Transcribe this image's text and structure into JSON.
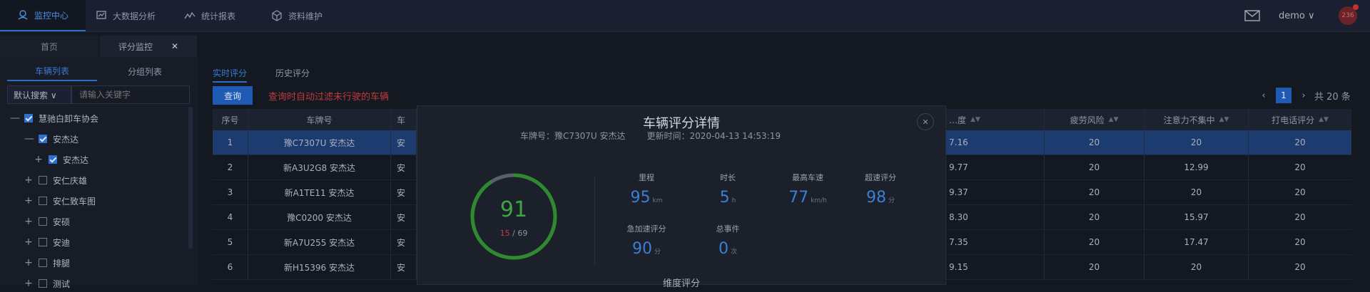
{
  "nav": {
    "items": [
      {
        "label": "监控中心",
        "icon": "monitor-icon",
        "active": true
      },
      {
        "label": "大数据分析",
        "icon": "bigdata-icon",
        "active": false
      },
      {
        "label": "统计报表",
        "icon": "chart-line-icon",
        "active": false
      },
      {
        "label": "资料维护",
        "icon": "cube-icon",
        "active": false
      }
    ],
    "user": "demo ∨",
    "avatar_text": "236"
  },
  "page_tabs": {
    "home": "首页",
    "current": "评分监控",
    "close": "✕"
  },
  "sidebar": {
    "tab_vehicles": "车辆列表",
    "tab_groups": "分组列表",
    "select_value": "默认搜索 ∨",
    "search_placeholder": "请输入关键字",
    "tree": [
      {
        "expander": "—",
        "checked": true,
        "label": "慧驰白卸车协会"
      },
      {
        "expander": "—",
        "checked": true,
        "label": "安杰达"
      },
      {
        "expander": "+",
        "checked": true,
        "label": "安杰达"
      },
      {
        "expander": "+",
        "checked": false,
        "label": "安仁庆雄"
      },
      {
        "expander": "+",
        "checked": false,
        "label": "安仁致车图"
      },
      {
        "expander": "+",
        "checked": false,
        "label": "安硕"
      },
      {
        "expander": "+",
        "checked": false,
        "label": "安迪"
      },
      {
        "expander": "+",
        "checked": false,
        "label": "排腿"
      },
      {
        "expander": "+",
        "checked": false,
        "label": "测试"
      }
    ]
  },
  "main": {
    "tab_realtime": "实时评分",
    "tab_history": "历史评分",
    "query_label": "查询",
    "warning": "查询时自动过滤未行驶的车辆",
    "pager": {
      "prev": "‹",
      "page": "1",
      "next": "›",
      "total": "共 20 条"
    }
  },
  "table": {
    "headers": [
      "序号",
      "车牌号",
      "车",
      "…度",
      "疲劳风险",
      "注意力不集中",
      "打电话评分"
    ],
    "rows": [
      [
        "1",
        "豫C7307U 安杰达",
        "安",
        "7.16",
        "20",
        "20",
        "20"
      ],
      [
        "2",
        "新A3U2G8 安杰达",
        "安",
        "9.77",
        "20",
        "12.99",
        "20"
      ],
      [
        "3",
        "新A1TE11 安杰达",
        "安",
        "9.37",
        "20",
        "20",
        "20"
      ],
      [
        "4",
        "豫C0200 安杰达",
        "安",
        "8.30",
        "20",
        "15.97",
        "20"
      ],
      [
        "5",
        "新A7U255 安杰达",
        "安",
        "7.35",
        "20",
        "17.47",
        "20"
      ],
      [
        "6",
        "新H15396 安杰达",
        "安",
        "9.15",
        "20",
        "20",
        "20"
      ]
    ]
  },
  "modal": {
    "title": "车辆评分详情",
    "plate": "车牌号：豫C7307U 安杰达",
    "time": "更新时间：2020-04-13 14:53:19",
    "close": "✕",
    "score": "91",
    "score_progress": 0.91,
    "rank_current": "15",
    "rank_total": " / 69",
    "stats": [
      {
        "label": "里程",
        "value": "95",
        "unit": "km"
      },
      {
        "label": "时长",
        "value": "5",
        "unit": "h"
      },
      {
        "label": "最高车速",
        "value": "77",
        "unit": "km/h"
      },
      {
        "label": "超速评分",
        "value": "98",
        "unit": "分"
      },
      {
        "label": "急加速评分",
        "value": "90",
        "unit": "分"
      },
      {
        "label": "总事件",
        "value": "0",
        "unit": "次"
      }
    ],
    "section": "维度评分"
  },
  "colors": {
    "accent": "#1f5bb5",
    "score_green": "#3da640",
    "warning_red": "#c03a3a",
    "selected_row": "#1c3b6f"
  }
}
